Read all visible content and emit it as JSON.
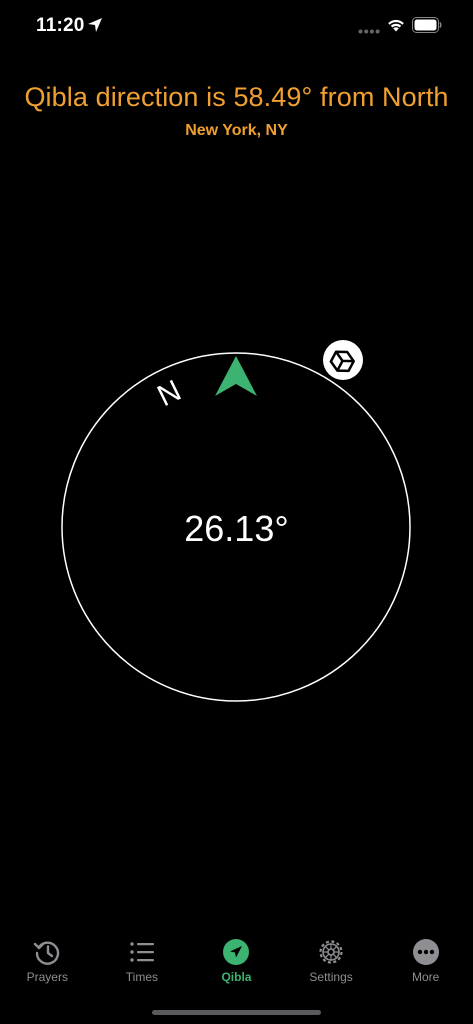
{
  "status_bar": {
    "time": "11:20"
  },
  "header": {
    "qibla_text": "Qibla direction is 58.49° from North",
    "city": "New York, NY"
  },
  "compass": {
    "heading": "26.13°",
    "north_label": "N"
  },
  "tabs": [
    {
      "label": "Prayers",
      "icon": "history-clock-icon"
    },
    {
      "label": "Times",
      "icon": "list-icon"
    },
    {
      "label": "Qibla",
      "icon": "navigation-arrow-icon"
    },
    {
      "label": "Settings",
      "icon": "gear-icon"
    },
    {
      "label": "More",
      "icon": "more-dots-icon"
    }
  ],
  "colors": {
    "accent_orange": "#f0a030",
    "accent_green": "#3cb371",
    "tab_inactive": "#8e8e93"
  }
}
